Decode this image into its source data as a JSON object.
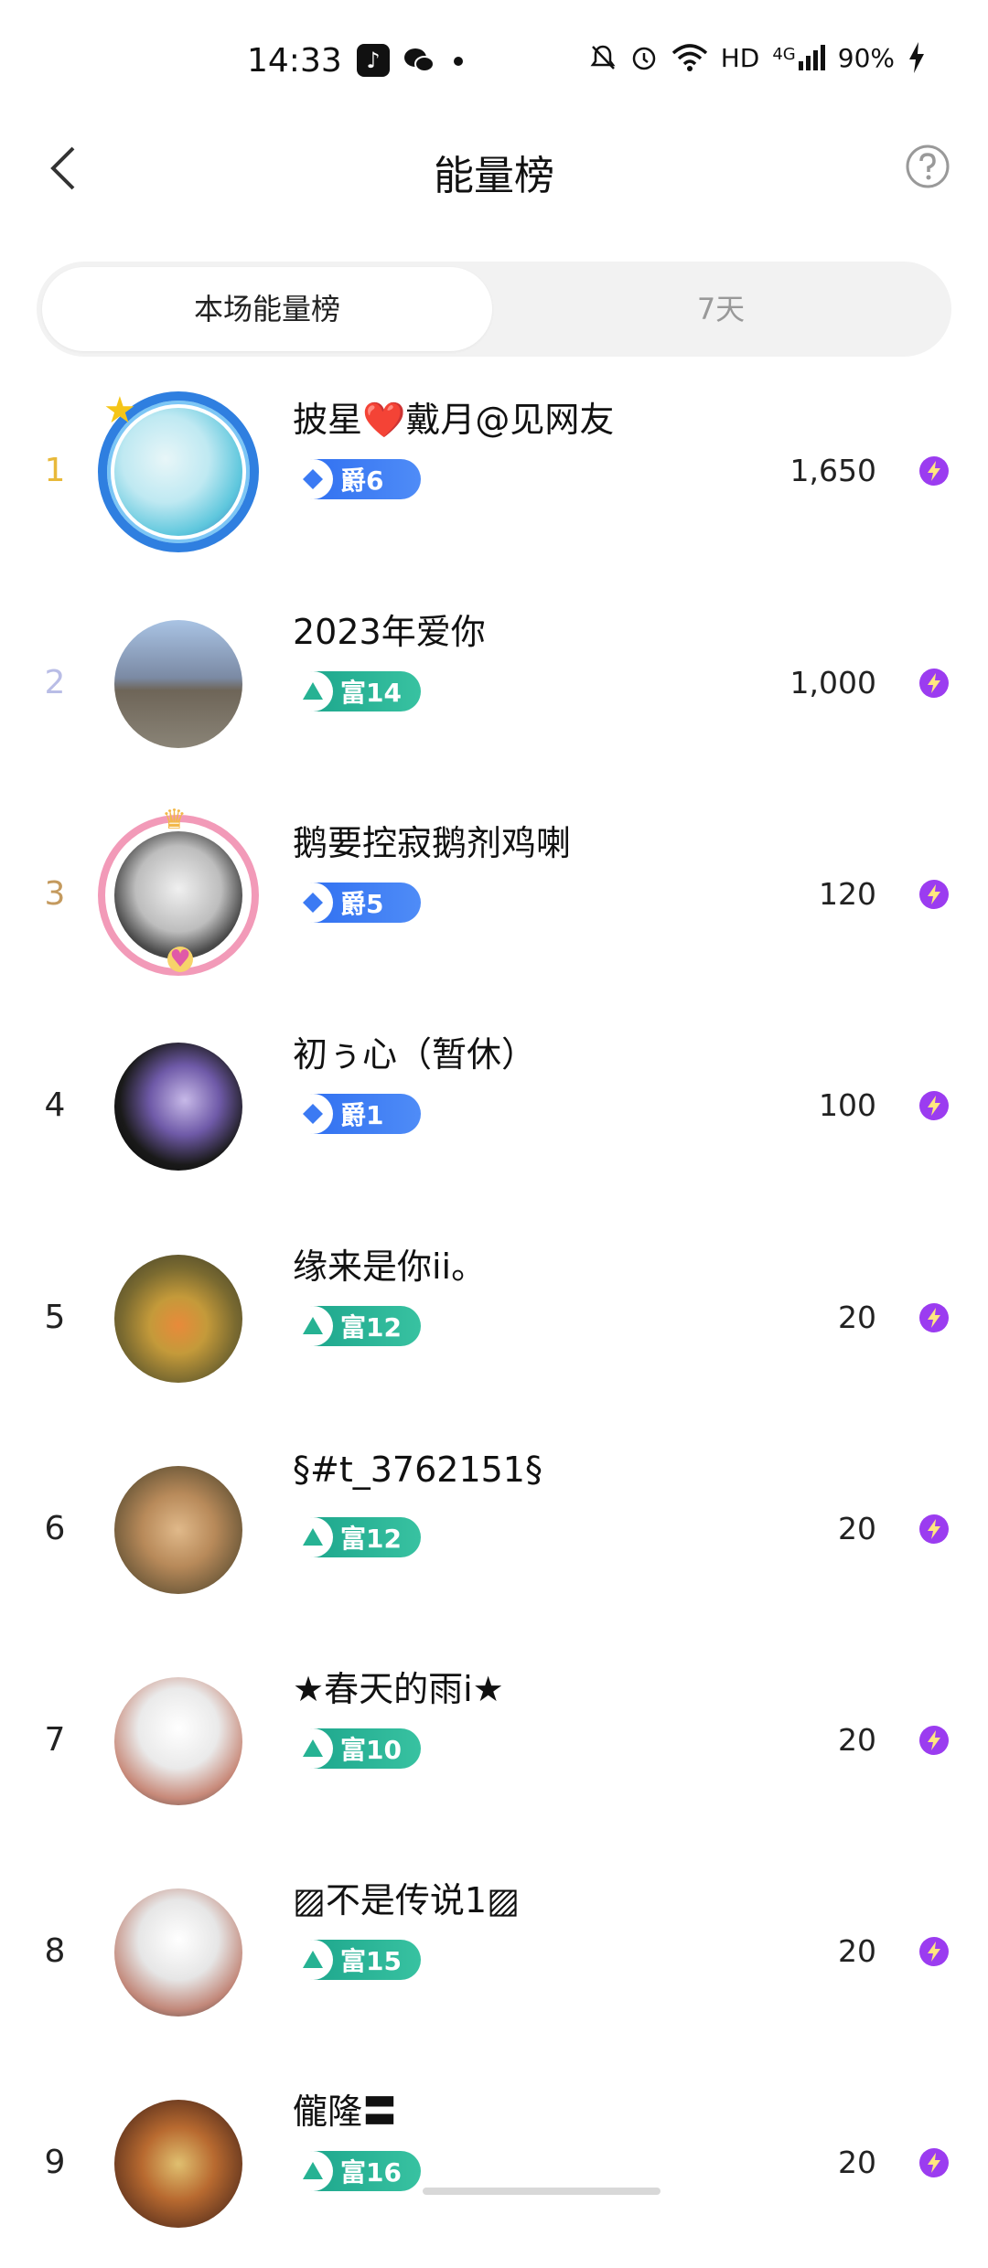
{
  "status_bar": {
    "time": "14:33",
    "hd": "HD",
    "network": "4G",
    "battery": "90%",
    "icons": [
      "tiktok-icon",
      "wechat-icon",
      "mute-icon",
      "alarm-icon",
      "wifi-icon",
      "signal-icon",
      "charging-icon"
    ]
  },
  "nav": {
    "title": "能量榜",
    "back_icon": "chevron-left-icon",
    "help_icon": "question-circle-icon"
  },
  "tabs": [
    {
      "label": "本场能量榜",
      "active": true
    },
    {
      "label": "7天",
      "active": false
    }
  ],
  "colors": {
    "rank1": "#e8b93a",
    "rank2": "#b9bde6",
    "rank3": "#c49a5e",
    "badge_jue": "#3b7af3",
    "badge_fu": "#26b293",
    "energy": "#9b3cf0"
  },
  "leaderboard": [
    {
      "rank": "1",
      "name": "披星❤️戴月@见网友",
      "badge": "爵6",
      "badge_type": "jue",
      "score": "1,650"
    },
    {
      "rank": "2",
      "name": "2023年爱你",
      "badge": "富14",
      "badge_type": "fu",
      "score": "1,000"
    },
    {
      "rank": "3",
      "name": "鹅要控寂鹅剂鸡喇",
      "badge": "爵5",
      "badge_type": "jue",
      "score": "120"
    },
    {
      "rank": "4",
      "name": "初ぅ心（暂休）",
      "badge": "爵1",
      "badge_type": "jue",
      "score": "100"
    },
    {
      "rank": "5",
      "name": "缘来是你ii。",
      "badge": "富12",
      "badge_type": "fu",
      "score": "20"
    },
    {
      "rank": "6",
      "name": "§#t_3762151§",
      "badge": "富12",
      "badge_type": "fu",
      "score": "20"
    },
    {
      "rank": "7",
      "name": "★春天的雨i★",
      "badge": "富10",
      "badge_type": "fu",
      "score": "20"
    },
    {
      "rank": "8",
      "name": "▨不是传说1▨",
      "badge": "富15",
      "badge_type": "fu",
      "score": "20"
    },
    {
      "rank": "9",
      "name": "儱隆〓",
      "badge": "富16",
      "badge_type": "fu",
      "score": "20"
    }
  ]
}
